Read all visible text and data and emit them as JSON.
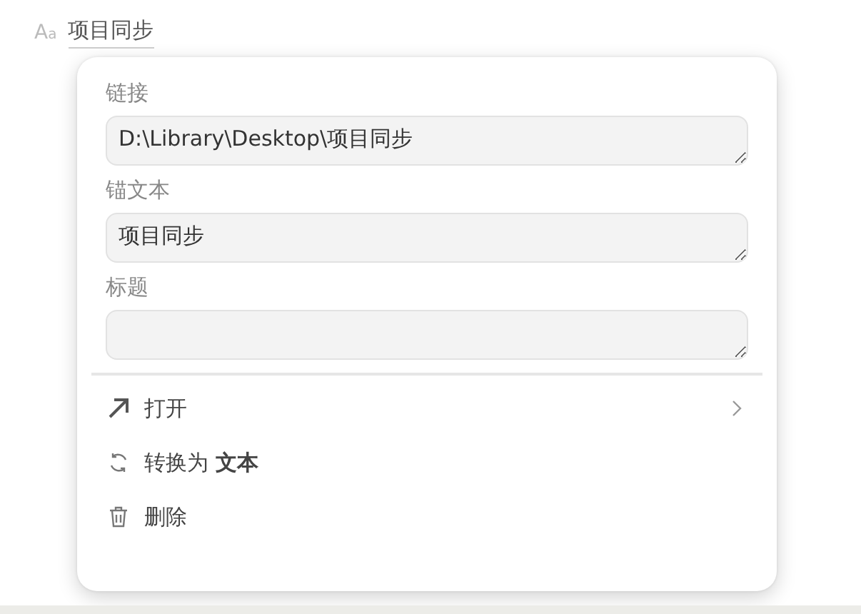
{
  "page_title": {
    "icon": "Aa",
    "text": "项目同步"
  },
  "link_popup": {
    "fields": [
      {
        "label": "链接",
        "value": "D:\\Library\\Desktop\\项目同步"
      },
      {
        "label": "锚文本",
        "value": "项目同步"
      },
      {
        "label": "标题"
      }
    ],
    "menu": [
      {
        "kind": "open",
        "label": "打开"
      },
      {
        "kind": "convert",
        "label": "转换为 **文本**"
      },
      {
        "kind": "delete",
        "label": "删除"
      }
    ]
  }
}
